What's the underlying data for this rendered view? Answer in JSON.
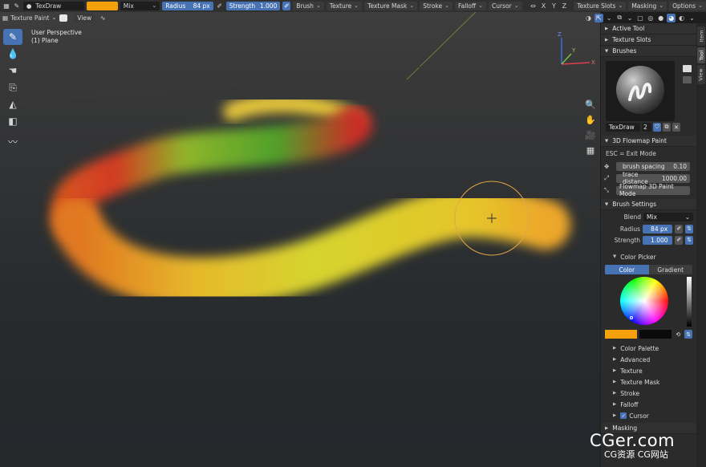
{
  "header": {
    "brush_name": "TexDraw",
    "blend": "Mix",
    "radius_label": "Radius",
    "radius_value": "84 px",
    "strength_label": "Strength",
    "strength_value": "1.000",
    "menus": [
      "Brush",
      "Texture",
      "Texture Mask",
      "Stroke",
      "Falloff",
      "Cursor"
    ],
    "axes": [
      "X",
      "Y",
      "Z"
    ],
    "texture_slots": "Texture Slots",
    "masking": "Masking",
    "options": "Options",
    "color": "#f5a10e"
  },
  "subheader": {
    "mode": "Texture Paint",
    "view": "View"
  },
  "viewport": {
    "perspective": "User Perspective",
    "object": "(1) Plane",
    "toolbar_icons": [
      "draw-icon",
      "soften-icon",
      "smear-icon",
      "clone-icon",
      "fill-icon",
      "mask-icon",
      "annotate-icon"
    ],
    "nav_icons": [
      "zoom-icon",
      "pan-icon",
      "camera-icon",
      "grid-icon"
    ],
    "gizmo_axes": [
      "Y",
      "Z",
      "X"
    ]
  },
  "panel": {
    "sections_top": [
      "Active Tool",
      "Texture Slots",
      "Brushes"
    ],
    "brush_datablock": "TexDraw",
    "brush_users": "2",
    "flowmap": {
      "title": "3D Flowmap Paint",
      "esc": "ESC = Exit Mode",
      "spacing_label": "brush spacing",
      "spacing_value": "0.10",
      "trace_label": "trace distance",
      "trace_value": "1000.00",
      "mode_button": "Flowmap 3D Paint Mode"
    },
    "brush_settings": {
      "title": "Brush Settings",
      "blend_label": "Blend",
      "blend_value": "Mix",
      "radius_label": "Radius",
      "radius_value": "84 px",
      "strength_label": "Strength",
      "strength_value": "1.000"
    },
    "color_picker": {
      "title": "Color Picker",
      "tab_color": "Color",
      "tab_gradient": "Gradient",
      "primary": "#f5a10e",
      "secondary": "#0a0a0a"
    },
    "subpanels": [
      "Color Palette",
      "Advanced",
      "Texture",
      "Texture Mask",
      "Stroke",
      "Falloff"
    ],
    "cursor_label": "Cursor",
    "masking": "Masking"
  },
  "tabs": [
    "Item",
    "Tool",
    "View"
  ],
  "watermark": {
    "line1": "CGer.com",
    "line2": "CG资源 CG网站"
  }
}
